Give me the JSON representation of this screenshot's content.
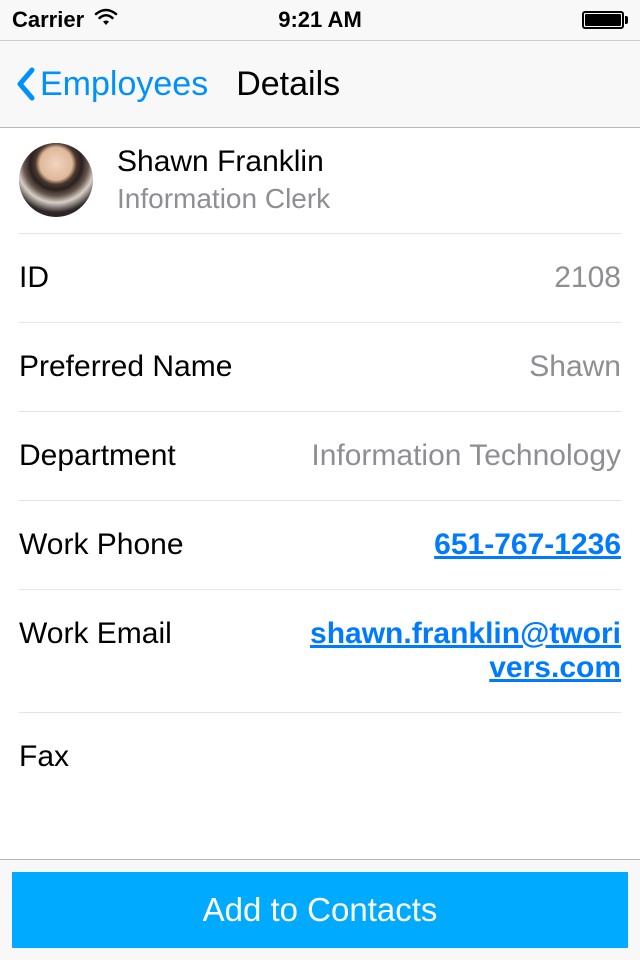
{
  "status_bar": {
    "carrier": "Carrier",
    "time": "9:21 AM"
  },
  "nav": {
    "back_label": "Employees",
    "title": "Details"
  },
  "profile": {
    "name": "Shawn Franklin",
    "job_title": "Information Clerk"
  },
  "fields": {
    "id": {
      "label": "ID",
      "value": "2108"
    },
    "preferred_name": {
      "label": "Preferred Name",
      "value": "Shawn"
    },
    "department": {
      "label": "Department",
      "value": "Information Technology"
    },
    "work_phone": {
      "label": "Work Phone",
      "value": "651-767-1236"
    },
    "work_email": {
      "label": "Work Email",
      "value": "shawn.franklin@tworivers.com"
    },
    "fax": {
      "label": "Fax",
      "value": ""
    }
  },
  "toolbar": {
    "add_contacts_label": "Add to Contacts"
  }
}
